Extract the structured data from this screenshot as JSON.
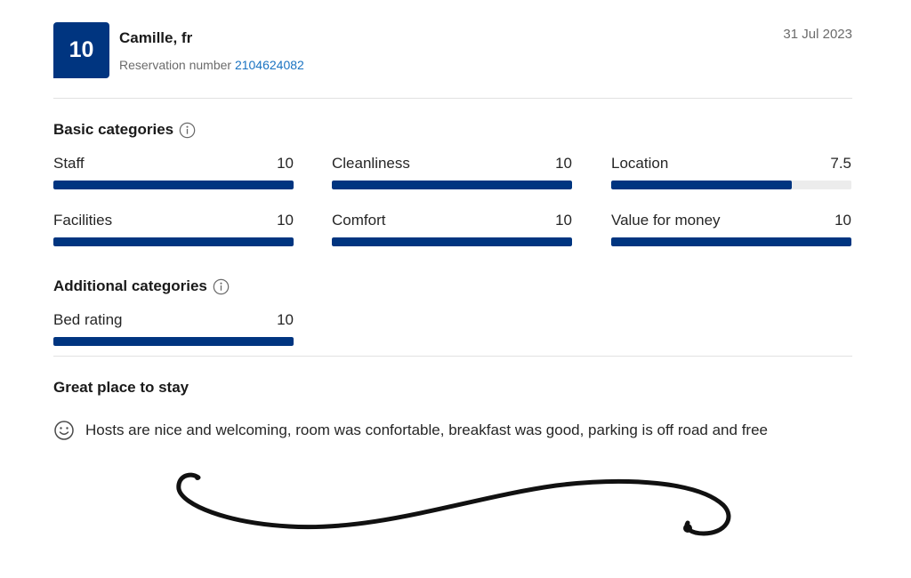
{
  "review": {
    "score": "10",
    "reviewer": "Camille, fr",
    "reservation_label": "Reservation number",
    "reservation_number": "2104624082",
    "date": "31 Jul 2023",
    "title": "Great place to stay",
    "positive_text": "Hosts are nice and welcoming, room was confortable, breakfast was good, parking is off road and free"
  },
  "basic": {
    "title": "Basic categories",
    "info_icon": "info-icon",
    "items": [
      {
        "label": "Staff",
        "score": "10",
        "fraction": 1.0
      },
      {
        "label": "Cleanliness",
        "score": "10",
        "fraction": 1.0
      },
      {
        "label": "Location",
        "score": "7.5",
        "fraction": 0.75
      },
      {
        "label": "Facilities",
        "score": "10",
        "fraction": 1.0
      },
      {
        "label": "Comfort",
        "score": "10",
        "fraction": 1.0
      },
      {
        "label": "Value for money",
        "score": "10",
        "fraction": 1.0
      }
    ]
  },
  "additional": {
    "title": "Additional categories",
    "info_icon": "info-icon",
    "items": [
      {
        "label": "Bed rating",
        "score": "10",
        "fraction": 1.0
      }
    ]
  },
  "colors": {
    "accent": "#003580",
    "link": "#1a73c2",
    "track": "#ececec"
  },
  "icons": {
    "positive": "smile-icon",
    "decoration": "flourish"
  }
}
